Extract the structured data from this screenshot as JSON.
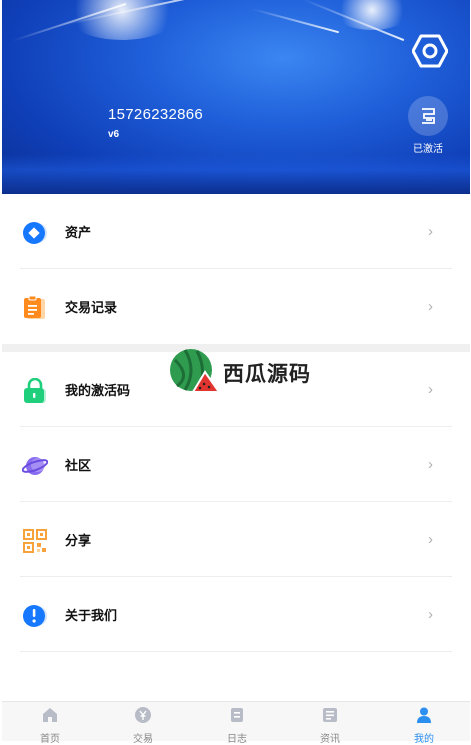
{
  "header": {
    "phone": "15726232866",
    "level": "v6",
    "activate_label": "已激活"
  },
  "menu": [
    {
      "label": "资产",
      "icon": "coin-icon",
      "color": "#1677ff"
    },
    {
      "label": "交易记录",
      "icon": "clipboard-icon",
      "color": "#ff8a1e"
    },
    {
      "label": "我的激活码",
      "icon": "lock-icon",
      "color": "#1fcf7c"
    },
    {
      "label": "社区",
      "icon": "planet-icon",
      "color": "#8a6cf0"
    },
    {
      "label": "分享",
      "icon": "qrcode-icon",
      "color": "#f7a23a"
    },
    {
      "label": "关于我们",
      "icon": "info-icon",
      "color": "#1677ff"
    }
  ],
  "watermark": "西瓜源码",
  "tabs": [
    {
      "label": "首页",
      "icon": "home-icon",
      "active": false
    },
    {
      "label": "交易",
      "icon": "yen-coin-icon",
      "active": false
    },
    {
      "label": "日志",
      "icon": "log-icon",
      "active": false
    },
    {
      "label": "资讯",
      "icon": "news-icon",
      "active": false
    },
    {
      "label": "我的",
      "icon": "user-icon",
      "active": true
    }
  ],
  "colors": {
    "accent": "#2a8fef",
    "header_blue": "#1f5fd9"
  }
}
